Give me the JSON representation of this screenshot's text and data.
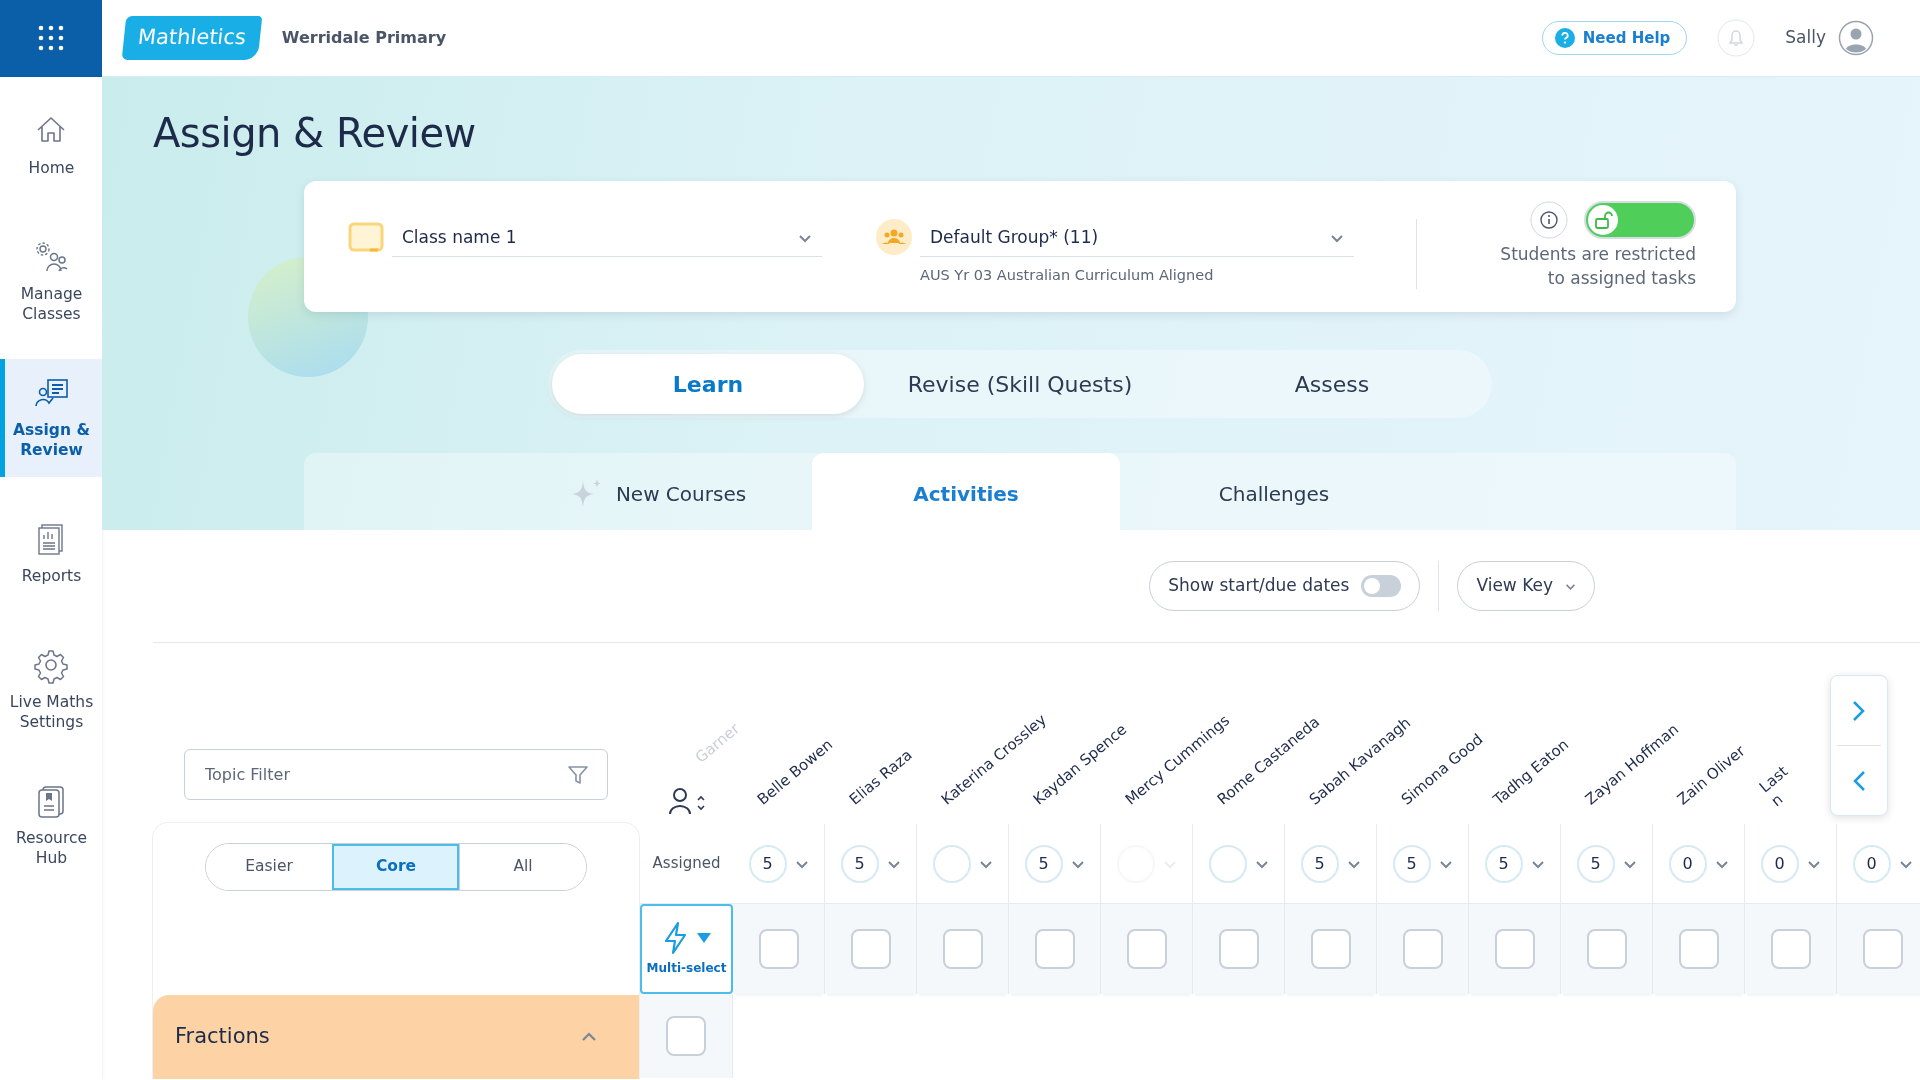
{
  "app": {
    "logo": "Mathletics",
    "school": "Werridale Primary",
    "help": "Need Help",
    "user": "Sally"
  },
  "sidebar": {
    "items": [
      {
        "label": "Home",
        "selected": false
      },
      {
        "label": "Manage Classes",
        "selected": false
      },
      {
        "label": "Assign & Review",
        "selected": true
      },
      {
        "label": "Reports",
        "selected": false
      },
      {
        "label": "Live Maths Settings",
        "selected": false
      },
      {
        "label": "Resource Hub",
        "selected": false
      }
    ]
  },
  "page_title": "Assign & Review",
  "selectors": {
    "class_name": "Class name 1",
    "group": "Default Group* (11)",
    "curriculum": "AUS Yr 03 Australian Curriculum Aligned",
    "restrict_on": true,
    "restrict_note": "Students are restricted to assigned tasks"
  },
  "tabs": [
    {
      "label": "Learn",
      "selected": true
    },
    {
      "label": "Revise (Skill Quests)",
      "selected": false
    },
    {
      "label": "Assess",
      "selected": false
    }
  ],
  "subtabs": [
    {
      "label": "New Courses",
      "selected": false,
      "icon": true
    },
    {
      "label": "Activities",
      "selected": true,
      "icon": false
    },
    {
      "label": "Challenges",
      "selected": false,
      "icon": false
    }
  ],
  "toolbar": {
    "dates_label": "Show start/due dates",
    "dates_on": false,
    "view_key": "View Key"
  },
  "topic_filter": {
    "placeholder": "Topic Filter"
  },
  "difficulty": [
    {
      "label": "Easier",
      "selected": false
    },
    {
      "label": "Core",
      "selected": true
    },
    {
      "label": "All",
      "selected": false
    }
  ],
  "topic": {
    "title": "Fractions",
    "expanded": true,
    "checked": false
  },
  "grid": {
    "clipped_name": "Garner",
    "assigned_label": "Assigned",
    "multiselect": "Multi-select",
    "students": [
      {
        "name": "Belle Bowen",
        "assigned": "5",
        "disabled": false,
        "checked": false
      },
      {
        "name": "Elias Raza",
        "assigned": "5",
        "disabled": false,
        "checked": false
      },
      {
        "name": "Katerina Crossley",
        "disabled": false,
        "checked": false
      },
      {
        "name": "Kaydan Spence",
        "assigned": "5",
        "disabled": false,
        "checked": false
      },
      {
        "name": "Mercy Cummings",
        "disabled": true,
        "checked": false
      },
      {
        "name": "Rome Castaneda",
        "disabled": false,
        "checked": false
      },
      {
        "name": "Sabah Kavanagh",
        "assigned": "5",
        "disabled": false,
        "checked": false
      },
      {
        "name": "Simona Good",
        "assigned": "5",
        "disabled": false,
        "checked": false
      },
      {
        "name": "Tadhg Eaton",
        "assigned": "5",
        "disabled": false,
        "checked": false
      },
      {
        "name": "Zayan Hoffman",
        "assigned": "5",
        "disabled": false,
        "checked": false
      },
      {
        "name": "Zain Oliver",
        "assigned": "0",
        "disabled": false,
        "checked": false
      },
      {
        "name": "Last n",
        "assigned": "0",
        "disabled": false,
        "checked": false
      },
      {
        "assigned": "0",
        "disabled": false,
        "checked": false
      }
    ]
  }
}
